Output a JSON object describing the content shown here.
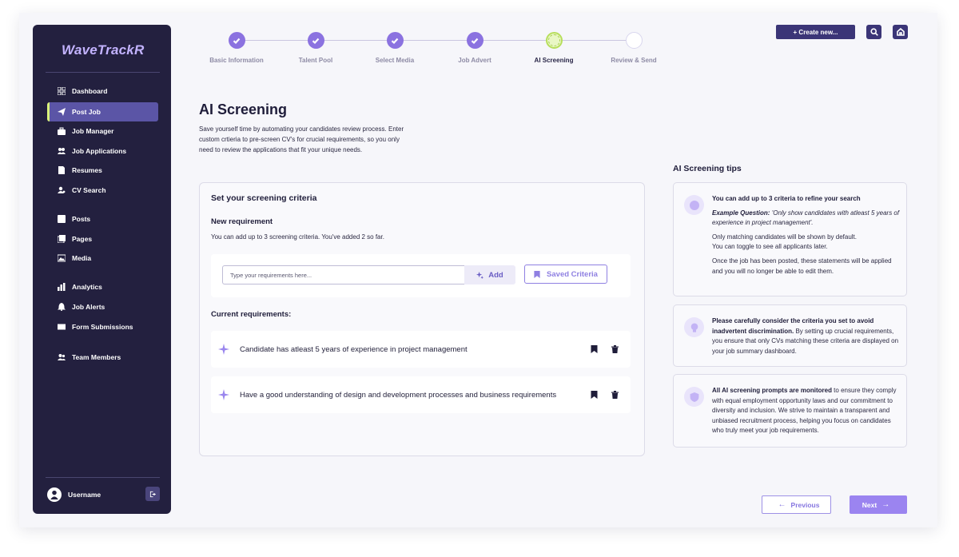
{
  "app": {
    "logo": "WaveTrackR"
  },
  "sidebar": {
    "items": [
      {
        "label": "Dashboard",
        "icon": "grid-icon"
      },
      {
        "label": "Post Job",
        "icon": "send-icon",
        "active": true
      },
      {
        "label": "Job Manager",
        "icon": "briefcase-icon"
      },
      {
        "label": "Job Applications",
        "icon": "people-icon"
      },
      {
        "label": "Resumes",
        "icon": "document-icon"
      },
      {
        "label": "CV Search",
        "icon": "user-search-icon"
      },
      {
        "label": "Posts",
        "icon": "posts-icon"
      },
      {
        "label": "Pages",
        "icon": "pages-icon"
      },
      {
        "label": "Media",
        "icon": "image-icon"
      },
      {
        "label": "Analytics",
        "icon": "bar-chart-icon"
      },
      {
        "label": "Job Alerts",
        "icon": "bell-icon"
      },
      {
        "label": "Form Submissions",
        "icon": "envelope-icon"
      },
      {
        "label": "Team Members",
        "icon": "team-icon"
      }
    ],
    "user": {
      "name": "Username"
    }
  },
  "stepper": {
    "steps": [
      {
        "label": "Basic Information",
        "state": "done"
      },
      {
        "label": "Talent Pool",
        "state": "done"
      },
      {
        "label": "Select Media",
        "state": "done"
      },
      {
        "label": "Job Advert",
        "state": "done"
      },
      {
        "label": "AI Screening",
        "state": "current"
      },
      {
        "label": "Review & Send",
        "state": "todo"
      }
    ]
  },
  "topbar": {
    "create_label": "+ Create new..."
  },
  "page": {
    "title": "AI Screening",
    "description": "Save yourself time by automating your candidates review process. Enter custom crtieria to pre-screen CV's for crucial requirements, so you only need to review the applications that fit your unique needs."
  },
  "criteria": {
    "title": "Set your screening criteria",
    "new_requirement": "New requirement",
    "note": "You can add up to 3 screening criteria. You've added 2 so far.",
    "input_placeholder": "Type your requirements here...",
    "add_label": "Add",
    "saved_label": "Saved Criteria",
    "current_title": "Current requirements:",
    "requirements": [
      "Candidate has atleast 5 years of experience in project management",
      "Have a good understanding of design and development processes and business requirements"
    ]
  },
  "tips": {
    "title": "AI Screening tips",
    "tip1": {
      "heading": "You can add up to 3 criteria to refine your search",
      "example_label": "Example Question:",
      "example_text": "'Only show candidates with atleast 5 years of experience in project management'.",
      "line1": "Only matching candidates will be shown by default.",
      "line2": "You can toggle to see all applicants later.",
      "line3": "Once the job has been posted, these statements will be applied and you will no longer be able to edit them."
    },
    "tip2": {
      "bold": "Please carefully consider the criteria you set to avoid inadvertent discrimination.",
      "text": " By setting up crucial requirements, you ensure that only CVs matching these criteria are displayed on your job summary dashboard."
    },
    "tip3": {
      "bold": "All AI screening prompts are monitored",
      "text": " to ensure they comply with equal employment opportunity laws and our commitment to diversity and inclusion. We strive to maintain a transparent and unbiased recruitment process, helping you focus on candidates who truly meet your job requirements."
    }
  },
  "footer": {
    "previous_label": "Previous",
    "next_label": "Next"
  }
}
